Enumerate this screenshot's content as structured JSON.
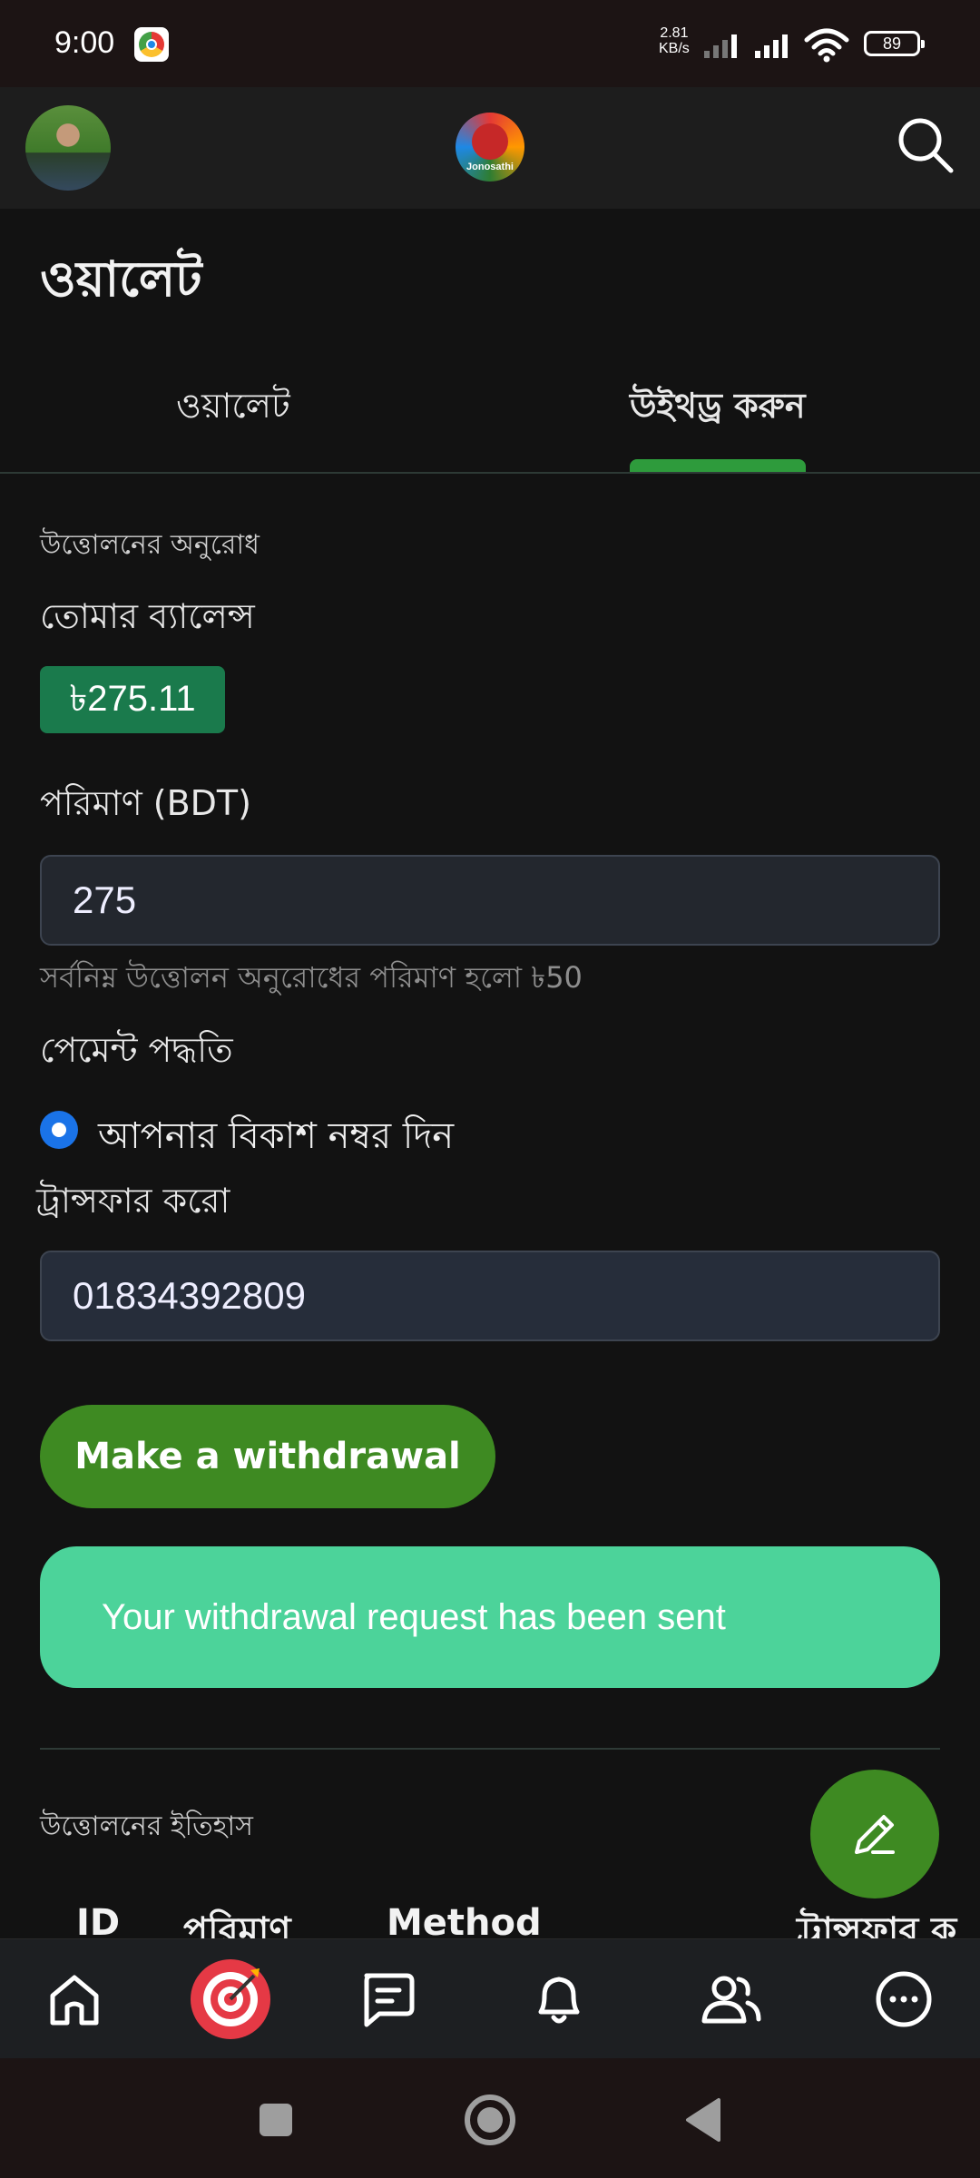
{
  "status_bar": {
    "time": "9:00",
    "net_speed_value": "2.81",
    "net_speed_unit": "KB/s",
    "battery": "89"
  },
  "header": {
    "brand_name": "Jonosathi",
    "icons": [
      "avatar",
      "brand-logo",
      "search-icon"
    ]
  },
  "page": {
    "title": "ওয়ালেট"
  },
  "tabs": [
    {
      "label": "ওয়ালেট",
      "active": false
    },
    {
      "label": "উইথড্র করুন",
      "active": true
    }
  ],
  "withdraw_form": {
    "section_label": "উত্তোলনের অনুরোধ",
    "balance_label": "তোমার ব্যালেন্স",
    "balance_value": "৳275.11",
    "amount_label": "পরিমাণ (BDT)",
    "amount_value": "275",
    "min_hint": "সর্বনিম্ন উত্তোলন অনুরোধের পরিমাণ হলো ৳50",
    "payment_method_label": "পেমেন্ট পদ্ধতি",
    "payment_option": "আপনার বিকাশ নম্বর দিন",
    "transfer_label": "ট্রান্সফার করো",
    "transfer_value": "01834392809",
    "submit_label": "Make a withdrawal",
    "success_message": "Your withdrawal request has been sent"
  },
  "history": {
    "section_label": "উত্তোলনের ইতিহাস",
    "columns": [
      "ID",
      "পরিমাণ",
      "Method",
      "ট্রান্সফার ক"
    ]
  },
  "colors": {
    "background": "#121212",
    "accent_green": "#3e8a22",
    "tab_indicator": "#2e9b3c",
    "balance_badge": "#1a7a4c",
    "alert_success": "#4cd39a",
    "radio_blue": "#1a73e8"
  },
  "bottom_nav": [
    "home-icon",
    "target-icon",
    "chat-icon",
    "bell-icon",
    "people-icon",
    "more-icon"
  ],
  "system_nav": [
    "recents-icon",
    "home-circle-icon",
    "back-icon"
  ]
}
